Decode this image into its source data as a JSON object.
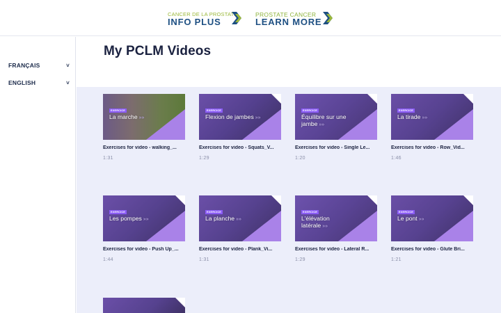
{
  "header": {
    "logo_fr_small": "CANCER DE LA PROSTATE",
    "logo_fr_big": "INFO PLUS",
    "logo_en_small": "PROSTATE CANCER",
    "logo_en_big": "LEARN MORE"
  },
  "sidebar": {
    "items": [
      {
        "label": "FRANÇAIS"
      },
      {
        "label": "ENGLISH"
      }
    ]
  },
  "main": {
    "title": "My PCLM Videos",
    "badge": "EXERCICE",
    "videos": [
      {
        "thumb_title": "La marche",
        "title": "Exercises for video - walking_...",
        "duration": "1:31"
      },
      {
        "thumb_title": "Flexion de jambes",
        "title": "Exercises for video - Squats_V...",
        "duration": "1:29"
      },
      {
        "thumb_title": "Équilibre sur une jambe",
        "title": "Exercises for video - Single Le...",
        "duration": "1:20"
      },
      {
        "thumb_title": "La tirade",
        "title": "Exercises for video - Row_Vid...",
        "duration": "1:46"
      },
      {
        "thumb_title": "Les pompes",
        "title": "Exercises for video - Push Up_...",
        "duration": "1:44"
      },
      {
        "thumb_title": "La planche",
        "title": "Exercises for video - Plank_Vi...",
        "duration": "1:31"
      },
      {
        "thumb_title": "L'élévation latérale",
        "title": "Exercises for video - Lateral R...",
        "duration": "1:29"
      },
      {
        "thumb_title": "Le pont",
        "title": "Exercises for video - Glute Bri...",
        "duration": "1:21"
      }
    ]
  },
  "colors": {
    "brand_navy": "#1d4f82",
    "brand_green": "#9bb83a",
    "accent_purple": "#8b5cf6",
    "grid_bg": "#eceefa"
  }
}
